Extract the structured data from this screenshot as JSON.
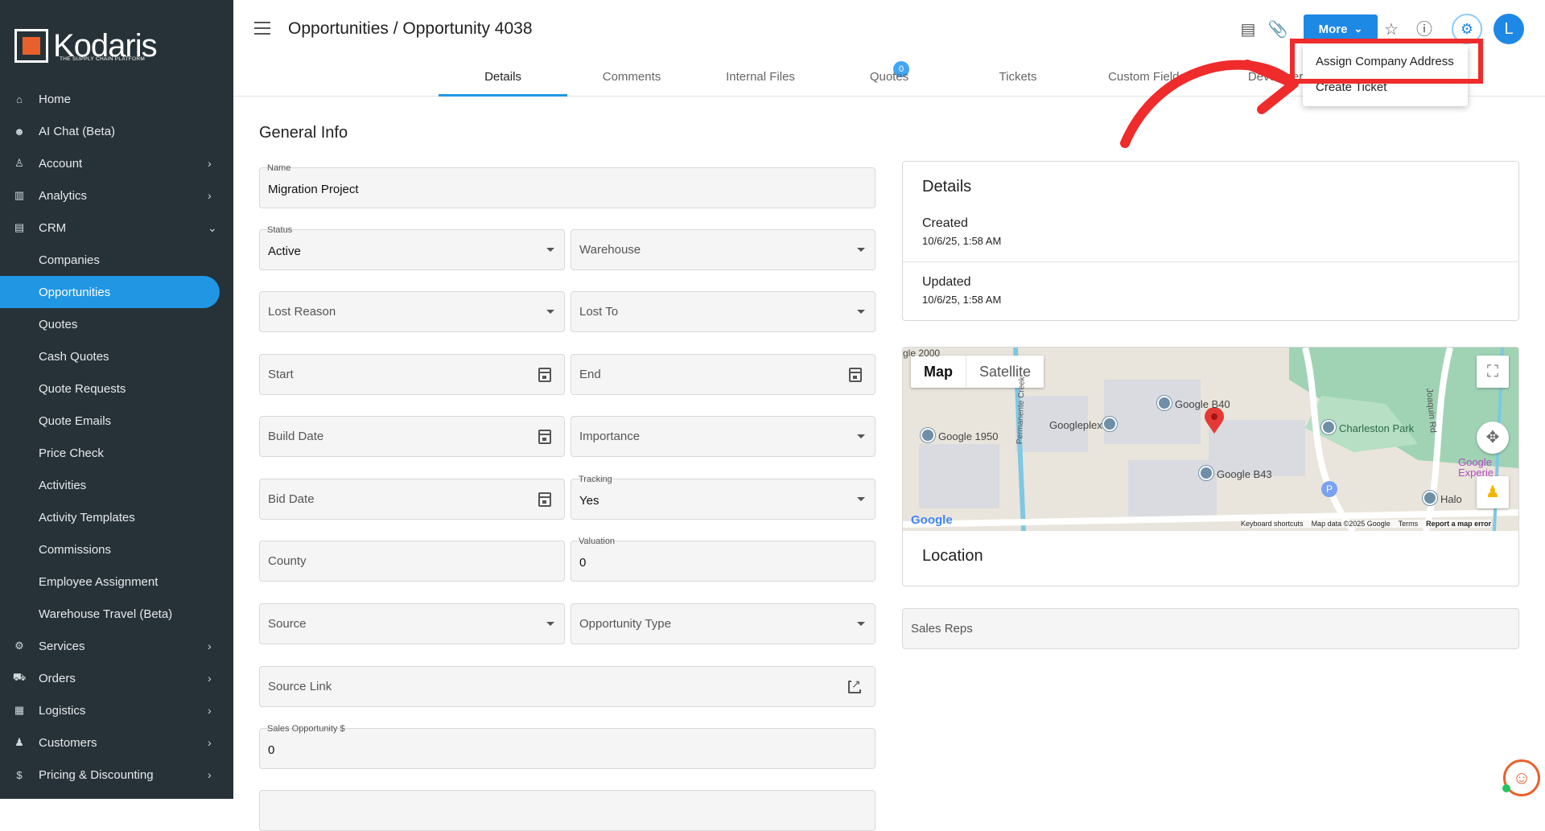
{
  "brand": {
    "name": "Kodaris",
    "tagline": "THE SUPPLY CHAIN PLATFORM",
    "accent": "#e8612c",
    "primary": "#1e88e5"
  },
  "sidebar": {
    "items": [
      {
        "label": "Home",
        "icon": "home-icon"
      },
      {
        "label": "AI Chat (Beta)",
        "icon": "robot-icon"
      },
      {
        "label": "Account",
        "icon": "person-icon",
        "chevron": true
      },
      {
        "label": "Analytics",
        "icon": "analytics-icon",
        "chevron": true
      },
      {
        "label": "CRM",
        "icon": "contacts-icon",
        "expanded": true
      },
      {
        "label": "Companies",
        "sub": true
      },
      {
        "label": "Opportunities",
        "sub": true,
        "active": true
      },
      {
        "label": "Quotes",
        "sub": true
      },
      {
        "label": "Cash Quotes",
        "sub": true
      },
      {
        "label": "Quote Requests",
        "sub": true
      },
      {
        "label": "Quote Emails",
        "sub": true
      },
      {
        "label": "Price Check",
        "sub": true
      },
      {
        "label": "Activities",
        "sub": true
      },
      {
        "label": "Activity Templates",
        "sub": true
      },
      {
        "label": "Commissions",
        "sub": true
      },
      {
        "label": "Employee Assignment",
        "sub": true
      },
      {
        "label": "Warehouse Travel (Beta)",
        "sub": true
      },
      {
        "label": "Services",
        "icon": "gears-icon",
        "chevron": true
      },
      {
        "label": "Orders",
        "icon": "truck-icon",
        "chevron": true
      },
      {
        "label": "Logistics",
        "icon": "logistics-icon",
        "chevron": true
      },
      {
        "label": "Customers",
        "icon": "people-icon",
        "chevron": true
      },
      {
        "label": "Pricing & Discounting",
        "icon": "dollar-icon",
        "chevron": true
      }
    ]
  },
  "header": {
    "title": "Opportunities / Opportunity 4038",
    "tabs": [
      "Details",
      "Comments",
      "Internal Files",
      "Quotes",
      "Tickets",
      "Custom Fields",
      "Developer"
    ],
    "comments_badge": "0",
    "more_label": "More",
    "avatar_letter": "L"
  },
  "more_menu": {
    "items": [
      "Assign Company Address",
      "Create Ticket"
    ]
  },
  "general_info": {
    "heading": "General Info",
    "name_label": "Name",
    "name_value": "Migration Project",
    "status_label": "Status",
    "status_value": "Active",
    "warehouse": "Warehouse",
    "lost_reason": "Lost Reason",
    "lost_to": "Lost To",
    "start": "Start",
    "end": "End",
    "build_date": "Build Date",
    "importance": "Importance",
    "bid_date": "Bid Date",
    "tracking_label": "Tracking",
    "tracking_value": "Yes",
    "county": "County",
    "valuation_label": "Valuation",
    "valuation_value": "0",
    "source": "Source",
    "opportunity_type": "Opportunity Type",
    "source_link": "Source Link",
    "sales_opp_label": "Sales Opportunity $",
    "sales_opp_value": "0"
  },
  "details": {
    "heading": "Details",
    "created_label": "Created",
    "created_value": "10/6/25, 1:58 AM",
    "updated_label": "Updated",
    "updated_value": "10/6/25, 1:58 AM"
  },
  "map": {
    "map_label": "Map",
    "satellite_label": "Satellite",
    "pois": [
      "Google B40",
      "Google 1950",
      "Googleplex",
      "Google B43",
      "Charleston Park",
      "Halo",
      "Permanente Creek",
      "Joaquin Rd",
      "Google Experie",
      "gle 2000"
    ],
    "legal": {
      "keyboard": "Keyboard shortcuts",
      "data": "Map data ©2025 Google",
      "terms": "Terms",
      "report": "Report a map error"
    },
    "logo": "Google",
    "location_heading": "Location"
  },
  "sales_reps": "Sales Reps"
}
